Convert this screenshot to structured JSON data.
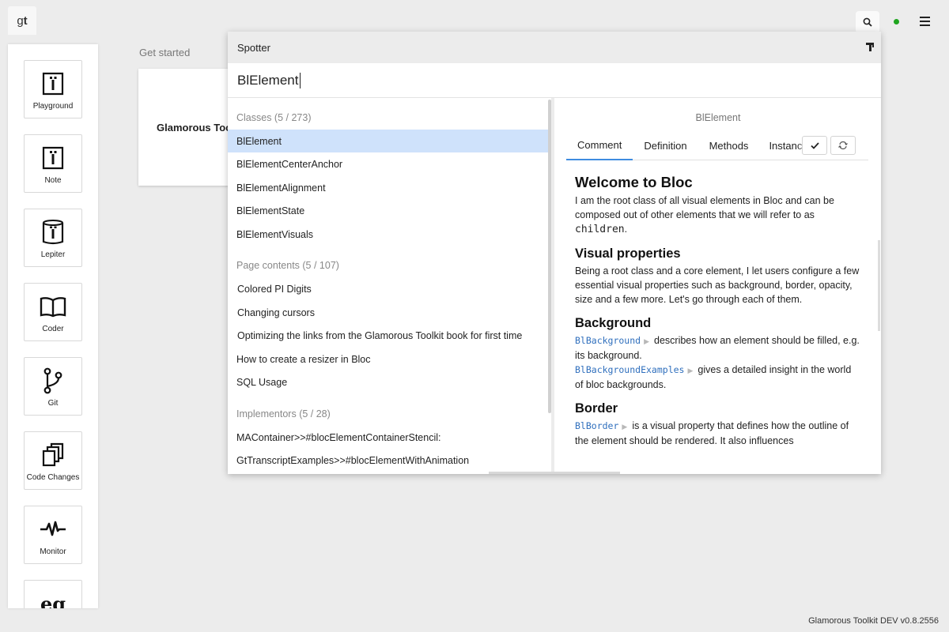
{
  "app": {
    "logo_g": "g",
    "logo_t": "t",
    "footer": "Glamorous Toolkit DEV v0.8.2556"
  },
  "sidebar": {
    "items": [
      {
        "label": "Playground",
        "icon": "playground-icon"
      },
      {
        "label": "Note",
        "icon": "note-icon"
      },
      {
        "label": "Lepiter",
        "icon": "lepiter-icon"
      },
      {
        "label": "Coder",
        "icon": "book-icon"
      },
      {
        "label": "Git",
        "icon": "git-branch-icon"
      },
      {
        "label": "Code Changes",
        "icon": "code-changes-icon"
      },
      {
        "label": "Monitor",
        "icon": "monitor-pulse-icon"
      },
      {
        "label": "",
        "icon": "examples-icon",
        "glyph": "eg"
      }
    ]
  },
  "background_page": {
    "title": "Get started",
    "card_text": "Glamorous Toolkit"
  },
  "spotter": {
    "title": "Spotter",
    "query": "BlElement",
    "groups": [
      {
        "title": "Classes (5 / 273)",
        "items": [
          "BlElement",
          "BlElementCenterAnchor",
          "BlElementAlignment",
          "BlElementState",
          "BlElementVisuals"
        ]
      },
      {
        "title": "Page contents (5 / 107)",
        "items": [
          "Colored PI Digits",
          "Changing cursors",
          "Optimizing the links from the Glamorous Toolkit book for first time",
          "How to create a resizer in Bloc",
          "SQL Usage"
        ]
      },
      {
        "title": "Implementors (5 / 28)",
        "items": [
          "MAContainer>>#blocElementContainerStencil:",
          "GtTranscriptExamples>>#blocElementWithAnimation"
        ]
      }
    ],
    "preview": {
      "title": "BlElement",
      "tabs": [
        "Comment",
        "Definition",
        "Methods",
        "Instance"
      ],
      "doc": {
        "h1": "Welcome to Bloc",
        "p1a": "I am the root class of all visual elements in Bloc and can be composed out of other elements that we will refer to as ",
        "p1code": "children",
        "p1b": ".",
        "h2": "Visual properties",
        "p2": "Being a root class and a core element, I let users configure a few essential visual properties such as background, border, opacity, size and a few more. Let's go through each of them.",
        "h3": "Background",
        "bg_link1": "BlBackground",
        "bg_text1": "describes how an element should be filled, e.g. its background.",
        "bg_link2": "BlBackgroundExamples",
        "bg_text2": "gives a detailed insight in the world of bloc backgrounds.",
        "h4": "Border",
        "border_link": "BlBorder",
        "border_text": "is a visual property that defines how the outline of the element should be rendered. It also influences"
      }
    }
  }
}
